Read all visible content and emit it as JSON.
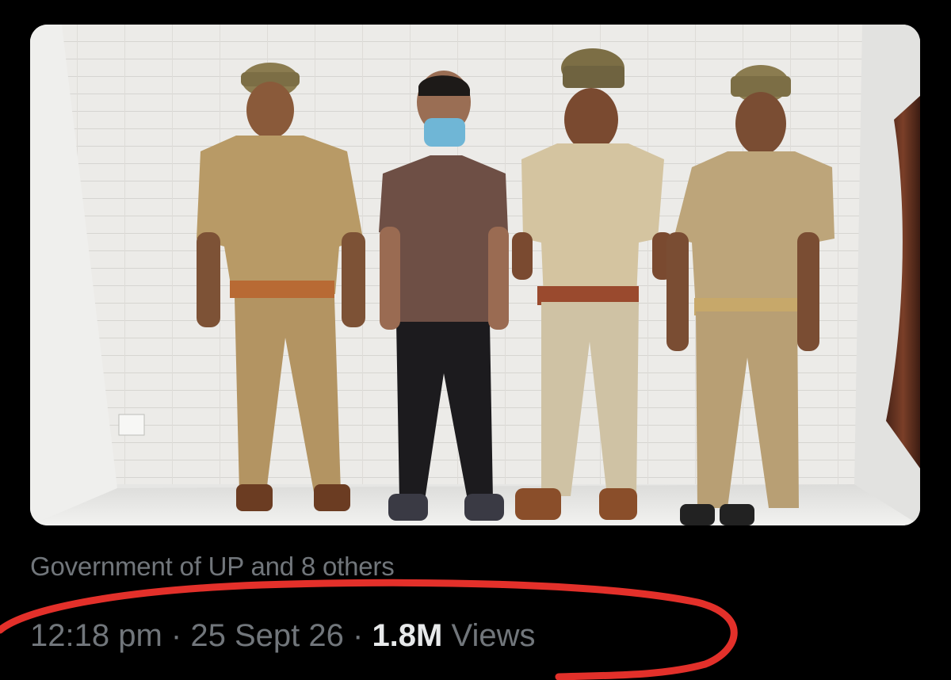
{
  "post": {
    "tagged_text": "Government of UP and 8 others",
    "time": "12:18 pm",
    "separator": "·",
    "date": "25 Sept 26",
    "views_count": "1.8M",
    "views_label": "Views"
  },
  "annotation": {
    "color": "#e3302a"
  }
}
